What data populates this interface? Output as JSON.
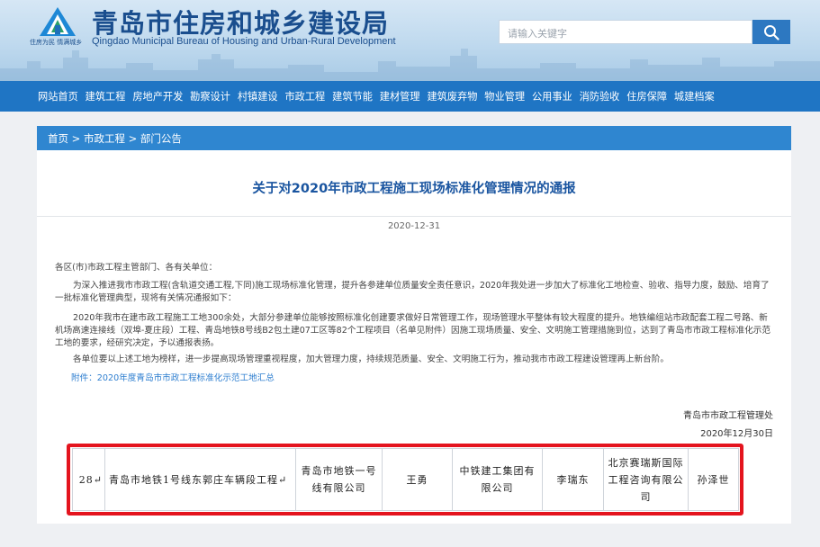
{
  "header": {
    "title": "青岛市住房和城乡建设局",
    "subtitle": "Qingdao Municipal Bureau of Housing and Urban-Rural Development",
    "logo_slogan": "住房为民 情满城乡",
    "search_placeholder": "请输入关键字",
    "search_icon": "search-icon"
  },
  "nav": {
    "items": [
      "网站首页",
      "建筑工程",
      "房地产开发",
      "勘察设计",
      "村镇建设",
      "市政工程",
      "建筑节能",
      "建材管理",
      "建筑废弃物",
      "物业管理",
      "公用事业",
      "消防验收",
      "住房保障",
      "城建档案"
    ]
  },
  "breadcrumb": {
    "items": [
      "首页",
      "市政工程",
      "部门公告"
    ],
    "separator": ">"
  },
  "article": {
    "title": "关于对2020年市政工程施工现场标准化管理情况的通报",
    "date": "2020-12-31",
    "salutation": "各区(市)市政工程主管部门、各有关单位：",
    "paragraph_1": "为深入推进我市市政工程(含轨道交通工程,下同)施工现场标准化管理，提升各参建单位质量安全责任意识，2020年我处进一步加大了标准化工地检查、验收、指导力度，鼓励、培育了一批标准化管理典型，现将有关情况通报如下：",
    "paragraph_2": "2020年我市在建市政工程施工工地300余处，大部分参建单位能够按照标准化创建要求做好日常管理工作，现场管理水平整体有较大程度的提升。地铁编组站市政配套工程二号路、新机场高速连接线（双埠-夏庄段）工程、青岛地铁8号线B2包土建07工区等82个工程项目（名单见附件）因施工现场质量、安全、文明施工管理措施到位，达到了青岛市市政工程标准化示范工地的要求，经研究决定，予以通报表扬。",
    "paragraph_3": "各单位要以上述工地为榜样，进一步提高现场管理重视程度，加大管理力度，持续规范质量、安全、文明施工行为，推动我市市政工程建设管理再上新台阶。",
    "attachment": "附件：2020年度青岛市市政工程标准化示范工地汇总",
    "signature": "青岛市市政工程管理处",
    "sign_date": "2020年12月30日"
  },
  "table": {
    "rows": [
      [
        "28↵",
        "青岛市地铁1号线东郭庄车辆段工程↵",
        "青岛市地铁一号线有限公司",
        "王勇",
        "中铁建工集团有限公司",
        "李瑞东",
        "北京赛瑞斯国际工程咨询有限公司",
        "孙泽世"
      ]
    ]
  },
  "colors": {
    "nav_bg": "#1f75c4",
    "breadcrumb_bg": "#2f86d0",
    "title_color": "#1a55a0",
    "highlight_frame": "#e4141e"
  }
}
